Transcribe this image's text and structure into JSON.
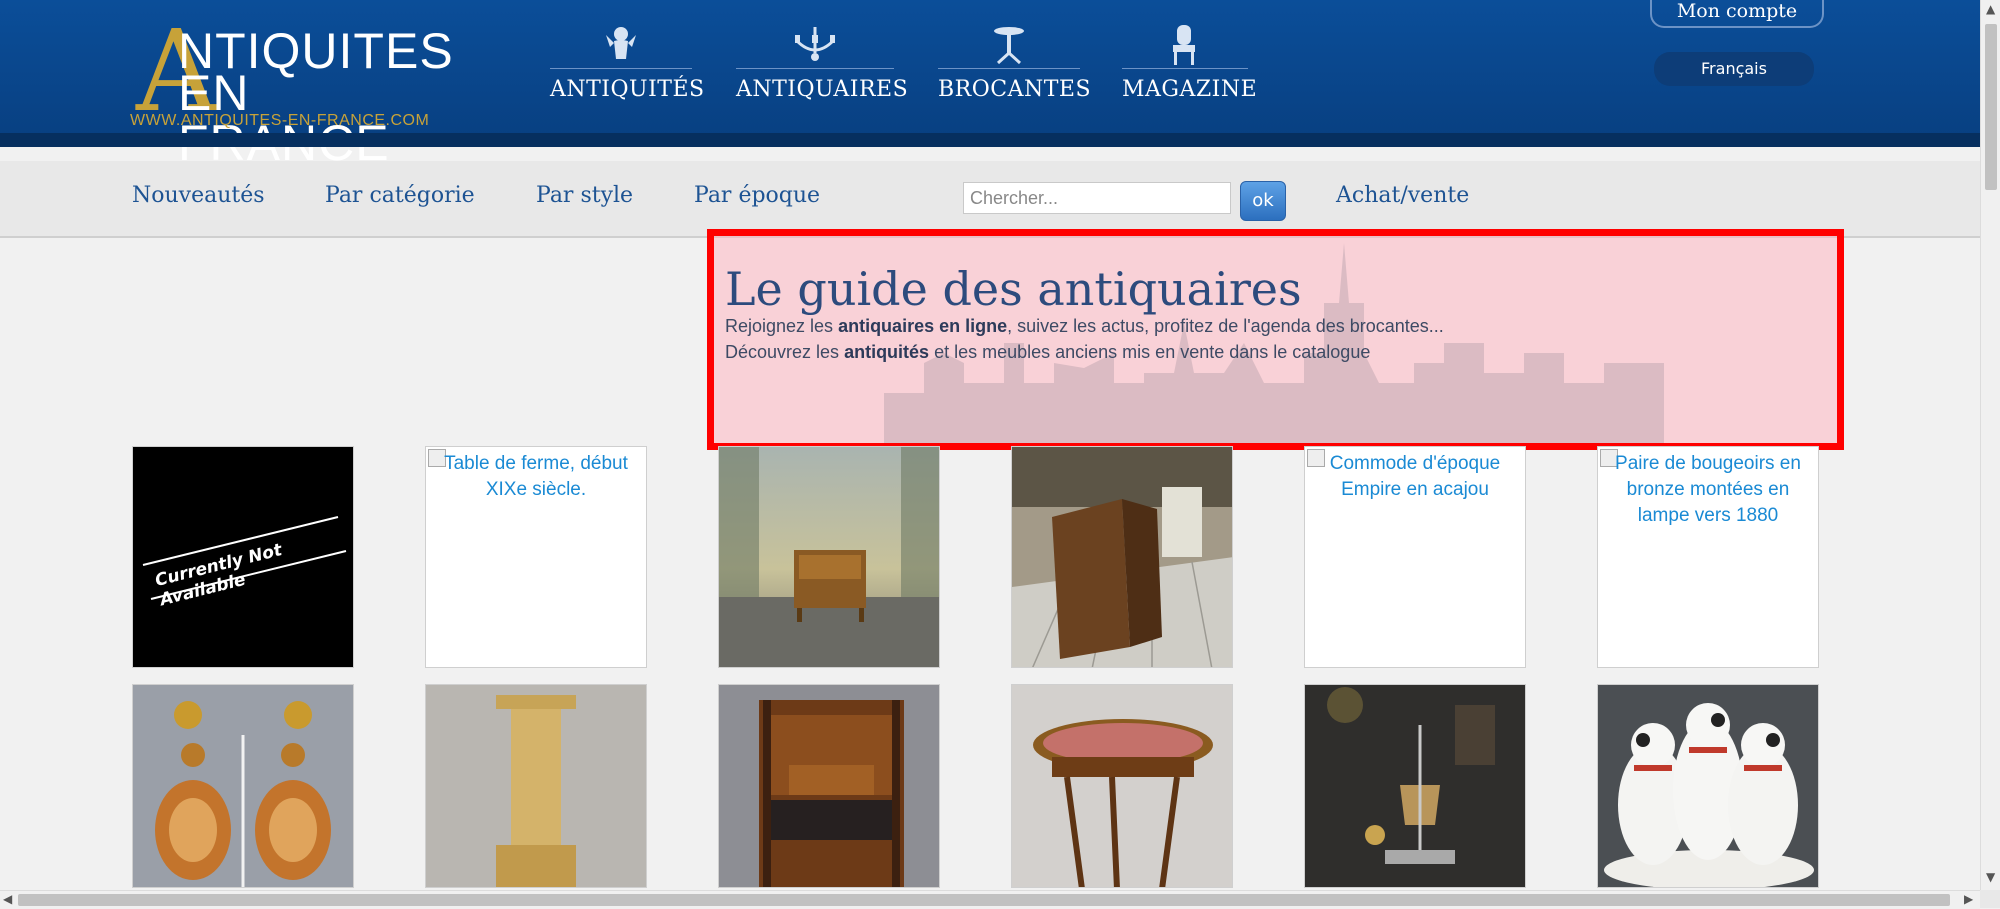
{
  "logo": {
    "letter": "A",
    "line1": "NTIQUITES",
    "line2": "EN FRANCE",
    "url": "WWW.ANTIQUITES-EN-FRANCE.COM"
  },
  "topnav": [
    {
      "label": "ANTIQUITÉS",
      "icon": "cherub-icon"
    },
    {
      "label": "ANTIQUAIRES",
      "icon": "chandelier-icon"
    },
    {
      "label": "BROCANTES",
      "icon": "gueridon-table-icon"
    },
    {
      "label": "MAGAZINE",
      "icon": "armchair-icon"
    }
  ],
  "account": {
    "label": "Mon compte"
  },
  "language": {
    "label": "Français"
  },
  "subnav": [
    {
      "label": "Nouveautés"
    },
    {
      "label": "Par catégorie"
    },
    {
      "label": "Par style"
    },
    {
      "label": "Par époque"
    },
    {
      "label": "Achat/vente"
    }
  ],
  "search": {
    "placeholder": "Chercher...",
    "button": "ok"
  },
  "hero": {
    "title": "Le guide des antiquaires",
    "line1": {
      "pre": "Rejoignez les ",
      "bold": "antiquaires en ligne",
      "post": ", suivez les actus, profitez de l'agenda des brocantes..."
    },
    "line2": {
      "pre": "Découvrez les ",
      "bold": "antiquités",
      "post": " et les meubles anciens mis en vente dans le catalogue"
    }
  },
  "grid": [
    {
      "type": "unavailable",
      "text": "Currently Not Available"
    },
    {
      "type": "broken",
      "alt": "Table de ferme, début XIXe siècle."
    },
    {
      "type": "photo",
      "subject": "small-cabinet"
    },
    {
      "type": "photo",
      "subject": "slant-front-desk"
    },
    {
      "type": "broken",
      "alt": "Commode d'époque Empire en acajou"
    },
    {
      "type": "broken",
      "alt": "Paire de bougeoirs en bronze montées en lampe vers 1880"
    },
    {
      "type": "photo",
      "subject": "cameo-earrings"
    },
    {
      "type": "photo",
      "subject": "marble-column"
    },
    {
      "type": "photo",
      "subject": "secretary-desk"
    },
    {
      "type": "photo",
      "subject": "gueridon-table"
    },
    {
      "type": "photo",
      "subject": "bouillotte-lamp"
    },
    {
      "type": "photo",
      "subject": "porcelain-dogs"
    }
  ]
}
